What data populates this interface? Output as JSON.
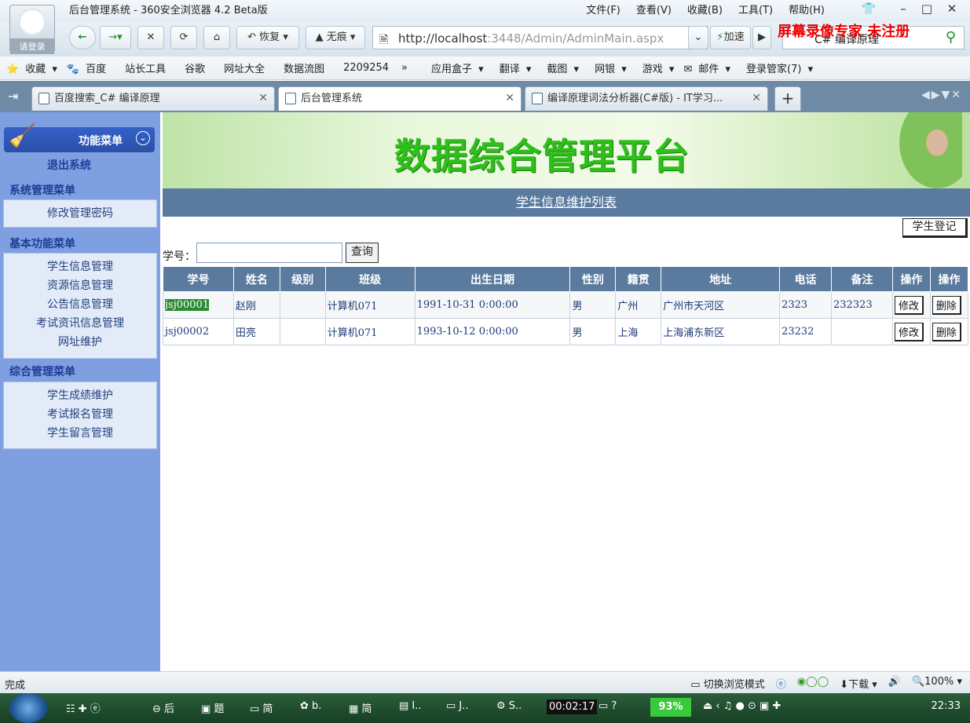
{
  "browser": {
    "window_title": "后台管理系统 - 360安全浏览器 4.2 Beta版",
    "menus": [
      "文件(F)",
      "查看(V)",
      "收藏(B)",
      "工具(T)",
      "帮助(H)"
    ],
    "login_label": "请登录",
    "restore_label": "恢复",
    "incognito_label": "无痕",
    "url_host": "http://localhost",
    "url_rest": ":3448/Admin/AdminMain.aspx",
    "speedup_label": "加速",
    "search_text": "C# 编译原理",
    "watermark": "屏幕录像专家 未注册",
    "favorites": [
      "收藏",
      "百度",
      "站长工具",
      "谷歌",
      "网址大全",
      "数据流图",
      "2209254",
      "»",
      "应用盒子",
      "翻译",
      "截图",
      "网银",
      "游戏",
      "邮件",
      "登录管家(7)"
    ],
    "tabs": [
      {
        "label": "百度搜索_C# 编译原理"
      },
      {
        "label": "后台管理系统"
      },
      {
        "label": "编译原理词法分析器(C#版) - IT学习..."
      }
    ],
    "status_text": "完成",
    "status_right": {
      "mode": "切换浏览模式",
      "download": "下载",
      "zoom": "100%"
    }
  },
  "sidebar": {
    "header": "功能菜单",
    "exit": "退出系统",
    "groups": [
      {
        "title": "系统管理菜单",
        "items": [
          "修改管理密码"
        ]
      },
      {
        "title": "基本功能菜单",
        "items": [
          "学生信息管理",
          "资源信息管理",
          "公告信息管理",
          "考试资讯信息管理",
          "网址维护"
        ]
      },
      {
        "title": "综合管理菜单",
        "items": [
          "学生成绩维护",
          "考试报名管理",
          "学生留言管理"
        ]
      }
    ]
  },
  "main": {
    "banner_title": "数据综合管理平台",
    "subheader": "学生信息维护列表",
    "register_button": "学生登记",
    "search_label": "学号：",
    "search_value": "",
    "query_button": "查询",
    "columns": [
      "学号",
      "姓名",
      "级别",
      "班级",
      "出生日期",
      "性别",
      "籍贯",
      "地址",
      "电话",
      "备注",
      "操作",
      "操作"
    ],
    "rows": [
      {
        "id": "jsj00001",
        "name": "赵刚",
        "level": "",
        "class": "计算机071",
        "birth": "1991-10-31 0:00:00",
        "gender": "男",
        "origin": "广州",
        "address": "广州市天河区",
        "phone": "2323",
        "note": "232323",
        "edit": "修改",
        "delete": "删除"
      },
      {
        "id": "jsj00002",
        "name": "田亮",
        "level": "",
        "class": "计算机071",
        "birth": "1993-10-12 0:00:00",
        "gender": "男",
        "origin": "上海",
        "address": "上海浦东新区",
        "phone": "23232",
        "note": "",
        "edit": "修改",
        "delete": "删除"
      }
    ]
  },
  "taskbar": {
    "items": [
      "后",
      "题",
      "简",
      "b.",
      "简",
      "I..",
      "J..",
      "S.."
    ],
    "timer": "00:02:17",
    "percent": "93%",
    "clock": "22:33"
  }
}
